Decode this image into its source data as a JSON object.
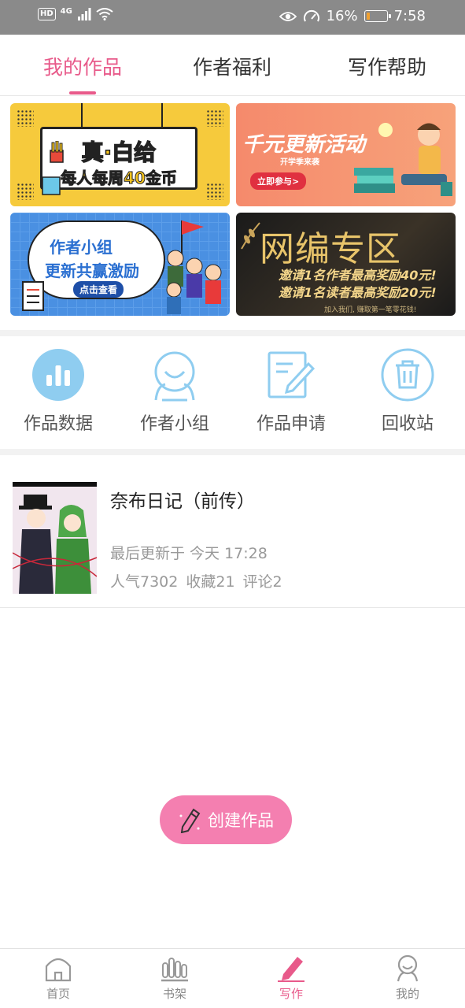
{
  "status_bar": {
    "network": "4G",
    "hd": "HD",
    "battery_percent": "16%",
    "battery_level": 0.16,
    "time": "7:58"
  },
  "tabs": [
    {
      "label": "我的作品",
      "active": true
    },
    {
      "label": "作者福利",
      "active": false
    },
    {
      "label": "写作帮助",
      "active": false
    }
  ],
  "banners": {
    "b1": {
      "title": "真·白给",
      "subtitle": "每人每周40金币"
    },
    "b2": {
      "title": "千元更新活动",
      "subtitle": "开学季来袭",
      "button": "立即参与>"
    },
    "b3": {
      "line1": "作者小组",
      "line2": "更新共赢激励",
      "button": "点击查看"
    },
    "b4": {
      "title": "网编专区",
      "line1": "邀请1名作者最高奖励40元!",
      "line2": "邀请1名读者最高奖励20元!",
      "footer": "加入我们, 赚取第一笔零花钱!"
    }
  },
  "actions": [
    {
      "label": "作品数据",
      "icon": "bar-chart-icon"
    },
    {
      "label": "作者小组",
      "icon": "group-icon"
    },
    {
      "label": "作品申请",
      "icon": "edit-document-icon"
    },
    {
      "label": "回收站",
      "icon": "trash-icon"
    }
  ],
  "work": {
    "title": "奈布日记（前传）",
    "updated": "最后更新于 今天 17:28",
    "popularity": "人气7302",
    "favorites": "收藏21",
    "comments": "评论2"
  },
  "create_button": {
    "label": "创建作品"
  },
  "bottom_nav": [
    {
      "label": "首页",
      "icon": "home-icon",
      "active": false
    },
    {
      "label": "书架",
      "icon": "bookshelf-icon",
      "active": false
    },
    {
      "label": "写作",
      "icon": "pen-icon",
      "active": true
    },
    {
      "label": "我的",
      "icon": "profile-icon",
      "active": false
    }
  ],
  "colors": {
    "accent": "#e85a8a",
    "create_button": "#f47fb0",
    "icon_blue": "#8fcdf0"
  }
}
